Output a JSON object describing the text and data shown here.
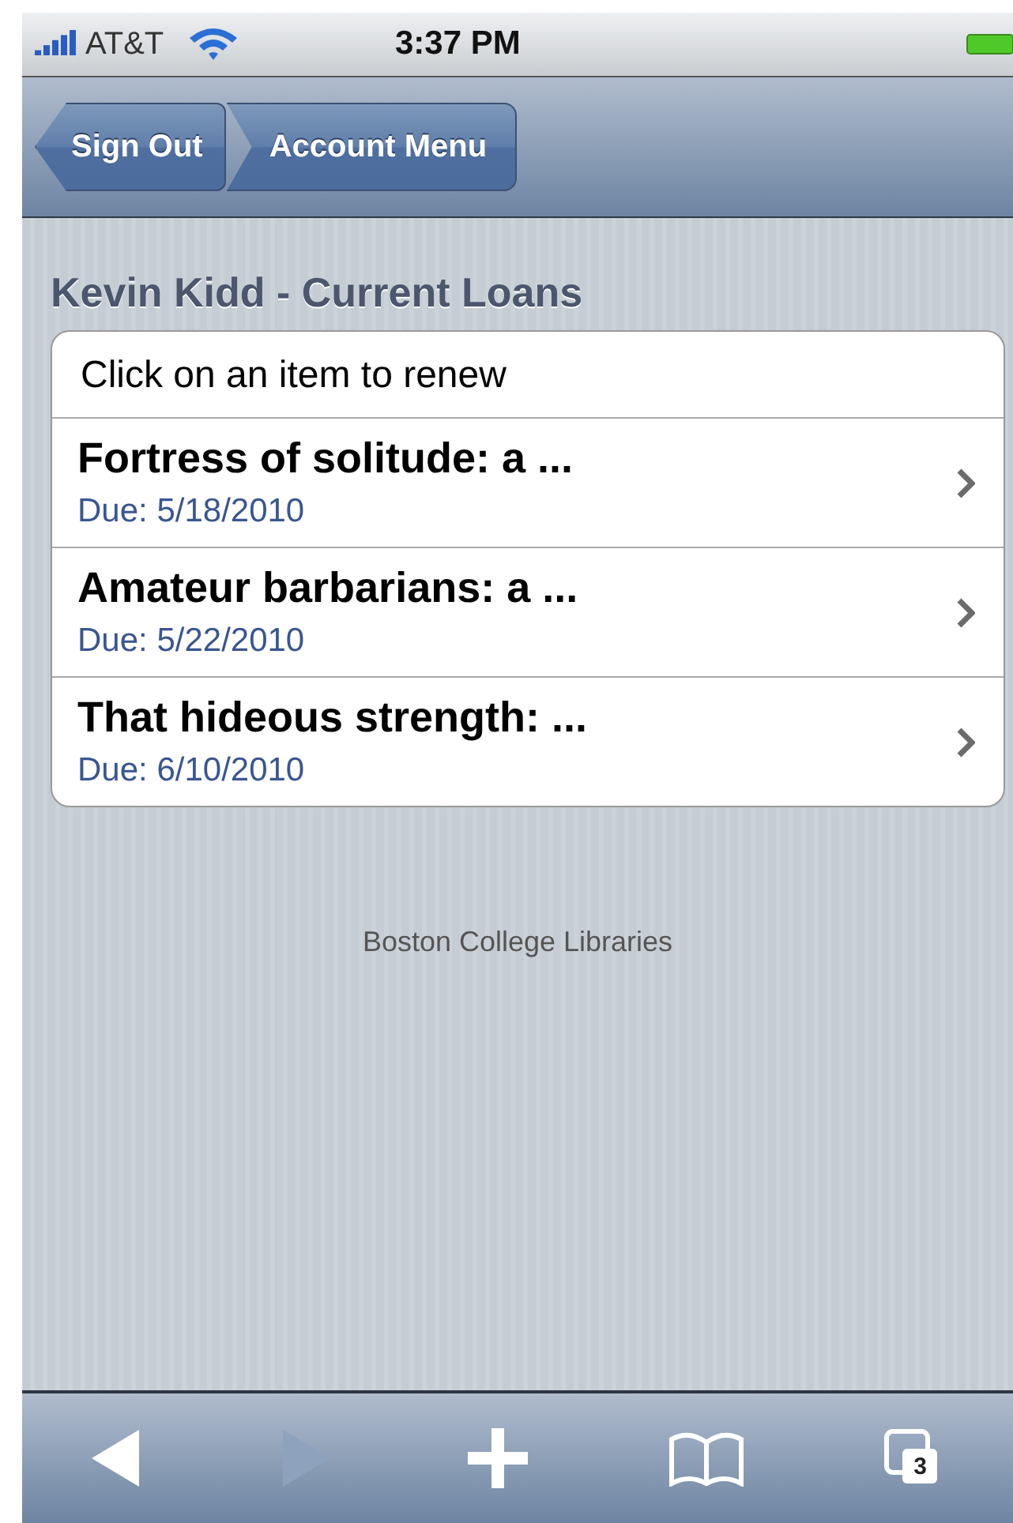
{
  "status_bar": {
    "carrier": "AT&T",
    "time": "3:37 PM"
  },
  "nav_bar": {
    "buttons": [
      {
        "label": "Sign Out"
      },
      {
        "label": "Account Menu"
      }
    ]
  },
  "title": "Kevin Kidd - Current Loans",
  "list": {
    "header": "Click on an item to renew",
    "items": [
      {
        "title": "Fortress of solitude: a ...",
        "due": "Due: 5/18/2010"
      },
      {
        "title": "Amateur barbarians: a ...",
        "due": "Due: 5/22/2010"
      },
      {
        "title": "That hideous strength: ...",
        "due": "Due: 6/10/2010"
      }
    ]
  },
  "footer": "Boston College Libraries",
  "toolbar": {
    "back_disabled": false,
    "forward_disabled": true,
    "tab_count": "3"
  }
}
